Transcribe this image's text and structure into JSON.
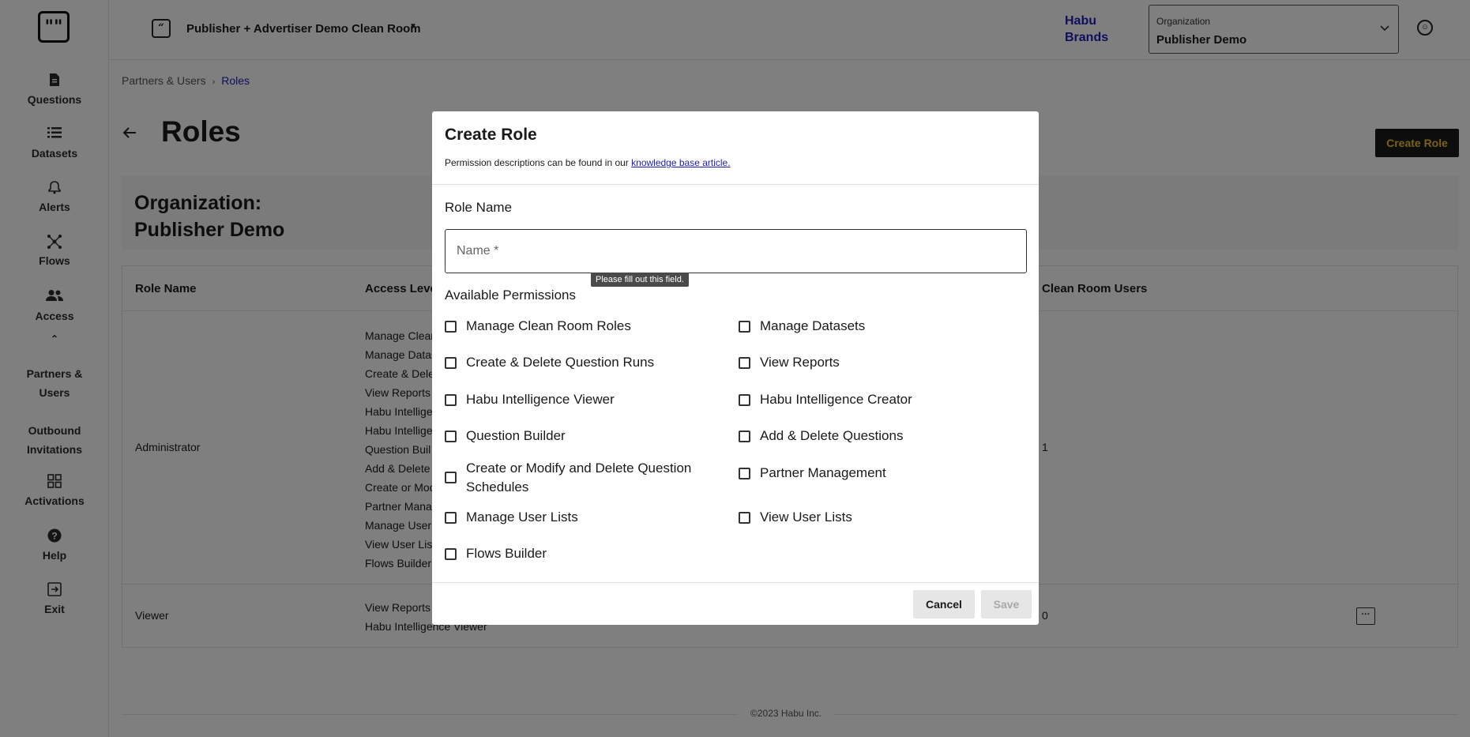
{
  "sidebar": {
    "logo": "\"\"",
    "items": [
      {
        "label": "Questions",
        "icon": "document-icon"
      },
      {
        "label": "Datasets",
        "icon": "list-icon"
      },
      {
        "label": "Alerts",
        "icon": "bell-icon"
      },
      {
        "label": "Flows",
        "icon": "flows-icon"
      },
      {
        "label": "Access",
        "icon": "people-icon"
      },
      {
        "label": "Partners & Users",
        "icon": ""
      },
      {
        "label": "Outbound Invitations",
        "icon": ""
      },
      {
        "label": "Activations",
        "icon": "grid-icon"
      },
      {
        "label": "Help",
        "icon": "help-icon"
      },
      {
        "label": "Exit",
        "icon": "exit-icon"
      }
    ]
  },
  "header": {
    "clean_room_title": "Publisher + Advertiser Demo Clean Room",
    "brand": "Habu Brands",
    "org_select_label": "Organization",
    "org_select_value": "Publisher Demo"
  },
  "breadcrumb": {
    "parent": "Partners & Users",
    "current": "Roles"
  },
  "page": {
    "title": "Roles",
    "create_button": "Create Role",
    "org_card_title_line1": "Organization:",
    "org_card_title_line2": "Publisher Demo"
  },
  "table": {
    "columns": [
      "Role Name",
      "Access Leve",
      "Clean Room Users"
    ],
    "rows": [
      {
        "role": "Administrator",
        "permissions": [
          "Manage Clean",
          "Manage Datas",
          "Create & Dele",
          "View Reports",
          "Habu Intellige",
          "Habu Intellige",
          "Question Buil",
          "Add & Delete",
          "Create or Mod",
          "Partner Mana",
          "Manage User",
          "View User Lis",
          "Flows Builder"
        ],
        "users": "1"
      },
      {
        "role": "Viewer",
        "permissions": [
          "View Reports",
          "Habu Intelligence Viewer"
        ],
        "users": "0"
      }
    ]
  },
  "footer": {
    "copyright": "©2023 Habu Inc."
  },
  "modal": {
    "title": "Create Role",
    "description_prefix": "Permission descriptions can be found in our",
    "description_link": "knowledge base article.",
    "role_name_label": "Role Name",
    "name_placeholder": "Name *",
    "name_value": "",
    "tooltip": "Please fill out this field.",
    "permissions_label": "Available Permissions",
    "permissions_left": [
      "Manage Clean Room Roles",
      "Create & Delete Question Runs",
      "Habu Intelligence Viewer",
      "Question Builder",
      "Create or Modify and Delete Question Schedules",
      "Manage User Lists",
      "Flows Builder"
    ],
    "permissions_right": [
      "Manage Datasets",
      "View Reports",
      "Habu Intelligence Creator",
      "Add & Delete Questions",
      "Partner Management",
      "View User Lists"
    ],
    "cancel_label": "Cancel",
    "save_label": "Save"
  },
  "colors": {
    "brand_link": "#1d1db8",
    "create_button_bg": "#1a1a1a",
    "create_button_text": "#f2c530",
    "overlay": "rgba(0,0,0,0.5)"
  }
}
